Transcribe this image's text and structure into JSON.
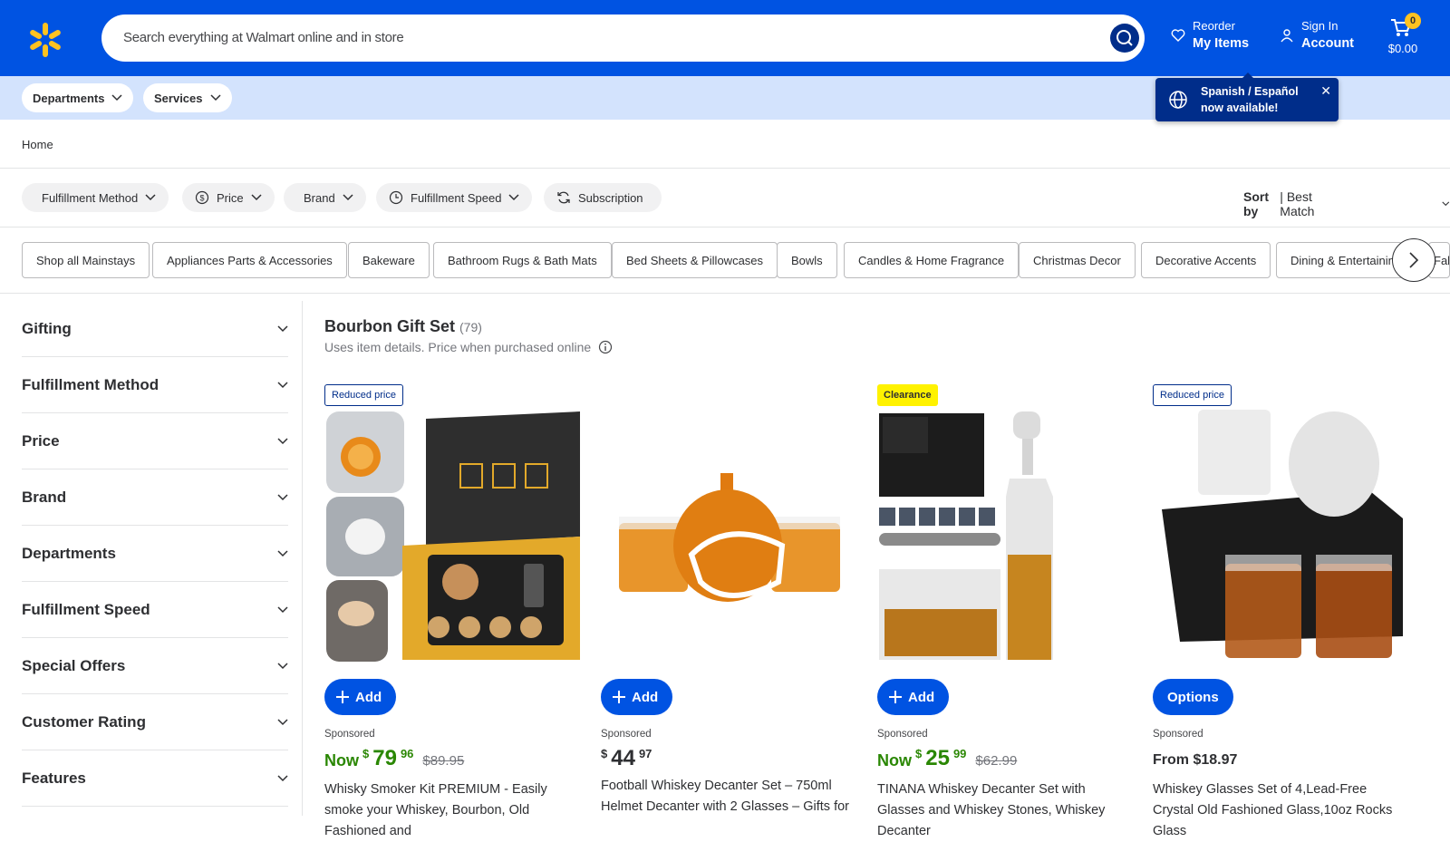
{
  "header": {
    "search_placeholder": "Search everything at Walmart online and in store",
    "reorder_small": "Reorder",
    "reorder_big": "My Items",
    "signin_small": "Sign In",
    "signin_big": "Account",
    "cart_count": "0",
    "cart_total": "$0.00"
  },
  "subnav": {
    "departments": "Departments",
    "services": "Services",
    "toast_text": "Spanish / Español now available!"
  },
  "breadcrumb": "Home",
  "filters": [
    "Fulfillment Method",
    "Price",
    "Brand",
    "Fulfillment Speed",
    "Subscription"
  ],
  "sort": {
    "label": "Sort by",
    "value": "| Best Match"
  },
  "chips": [
    "Shop all Mainstays",
    "Appliances Parts & Accessories",
    "Bakeware",
    "Bathroom Rugs & Bath Mats",
    "Bed Sheets & Pillowcases",
    "Bowls",
    "Candles & Home Fragrance",
    "Christmas Decor",
    "Decorative Accents",
    "Dining & Entertaining",
    "Fall"
  ],
  "facets": [
    "Gifting",
    "Fulfillment Method",
    "Price",
    "Brand",
    "Departments",
    "Fulfillment Speed",
    "Special Offers",
    "Customer Rating",
    "Features"
  ],
  "results": {
    "title": "Bourbon Gift Set",
    "count": "(79)",
    "subtitle": "Uses item details. Price when purchased online"
  },
  "products": [
    {
      "tag": "Reduced price",
      "button": "Add",
      "sponsored": "Sponsored",
      "now": "Now",
      "dollars": "79",
      "cents": "96",
      "was": "$89.95",
      "title": "Whisky Smoker Kit PREMIUM - Easily smoke your Whiskey, Bourbon, Old Fashioned and"
    },
    {
      "tag": "",
      "button": "Add",
      "sponsored": "Sponsored",
      "dollars": "44",
      "cents": "97",
      "title": "Football Whiskey Decanter Set – 750ml Helmet Decanter with 2 Glasses – Gifts for"
    },
    {
      "tag": "Clearance",
      "button": "Add",
      "sponsored": "Sponsored",
      "now": "Now",
      "dollars": "25",
      "cents": "99",
      "was": "$62.99",
      "title": "TINANA Whiskey Decanter Set with Glasses and Whiskey Stones, Whiskey Decanter"
    },
    {
      "tag": "Reduced price",
      "button": "Options",
      "sponsored": "Sponsored",
      "from": "From $18.97",
      "title": "Whiskey Glasses Set of 4,Lead-Free Crystal Old Fashioned Glass,10oz Rocks Glass"
    }
  ],
  "colors": {
    "brand_blue": "#0053e2",
    "spark_yellow": "#ffc220",
    "price_green": "#2a8703",
    "subnav_bg": "#d3e3fd"
  }
}
